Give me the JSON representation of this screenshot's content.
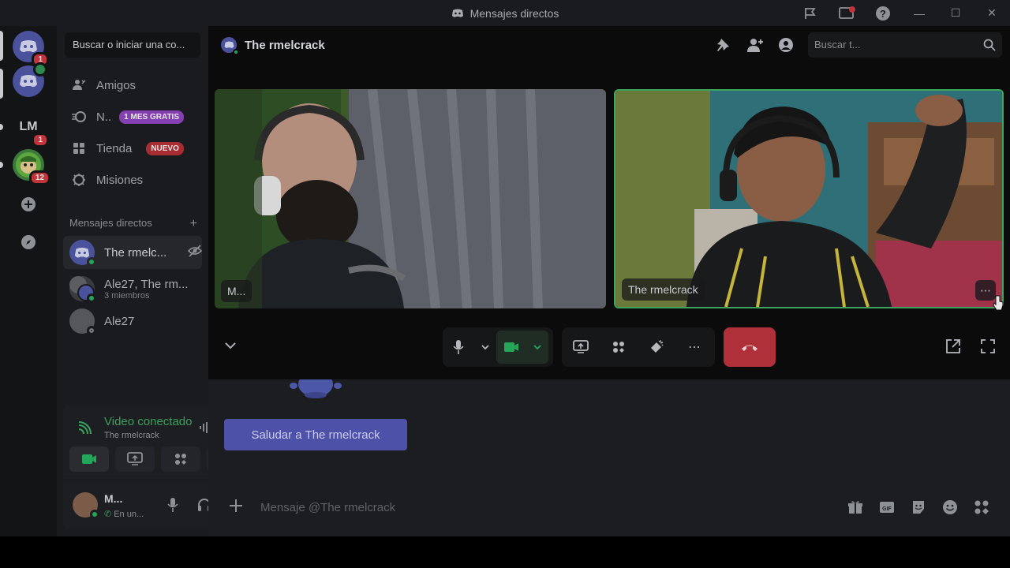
{
  "titlebar": {
    "title": "Mensajes directos",
    "buttons": [
      "flag-icon",
      "monitor-icon",
      "help-icon",
      "minimize",
      "maximize",
      "close"
    ]
  },
  "rail": {
    "servers": [
      {
        "icon": "discord-logo",
        "badge": "1"
      },
      {
        "icon": "discord-logo",
        "badge": ""
      },
      {
        "label": "LM",
        "badge": "1"
      },
      {
        "icon": "cartoon-avatar",
        "badge": "12"
      }
    ]
  },
  "sidebar": {
    "search_placeholder": "Buscar o iniciar una co...",
    "nav": [
      {
        "label": "Amigos",
        "icon": "friends-icon"
      },
      {
        "label": "N..",
        "icon": "nitro-icon",
        "tag": "1 MES GRATIS"
      },
      {
        "label": "Tienda",
        "icon": "shop-icon",
        "tag": "NUEVO"
      },
      {
        "label": "Misiones",
        "icon": "quests-icon"
      }
    ],
    "dm_header": "Mensajes directos",
    "dms": [
      {
        "name": "The rmelc...",
        "sub": ""
      },
      {
        "name": "Ale27, The rm...",
        "sub": "3 miembros"
      },
      {
        "name": "Ale27",
        "sub": ""
      }
    ]
  },
  "voice": {
    "status": "Video conectado",
    "channel": "The rmelcrack"
  },
  "user": {
    "name": "M...",
    "status": "En un..."
  },
  "main": {
    "header_name": "The rmelcrack",
    "search_placeholder": "Buscar t...",
    "tiles": [
      {
        "label": "M..."
      },
      {
        "label": "The rmelcrack"
      }
    ],
    "greet_button": "Saludar a The rmelcrack",
    "message_placeholder": "Mensaje @The rmelcrack"
  },
  "colors": {
    "brand": "#5865f2",
    "online": "#23a55a",
    "danger": "#da373c",
    "active_tile_border": "#3ba55d"
  }
}
